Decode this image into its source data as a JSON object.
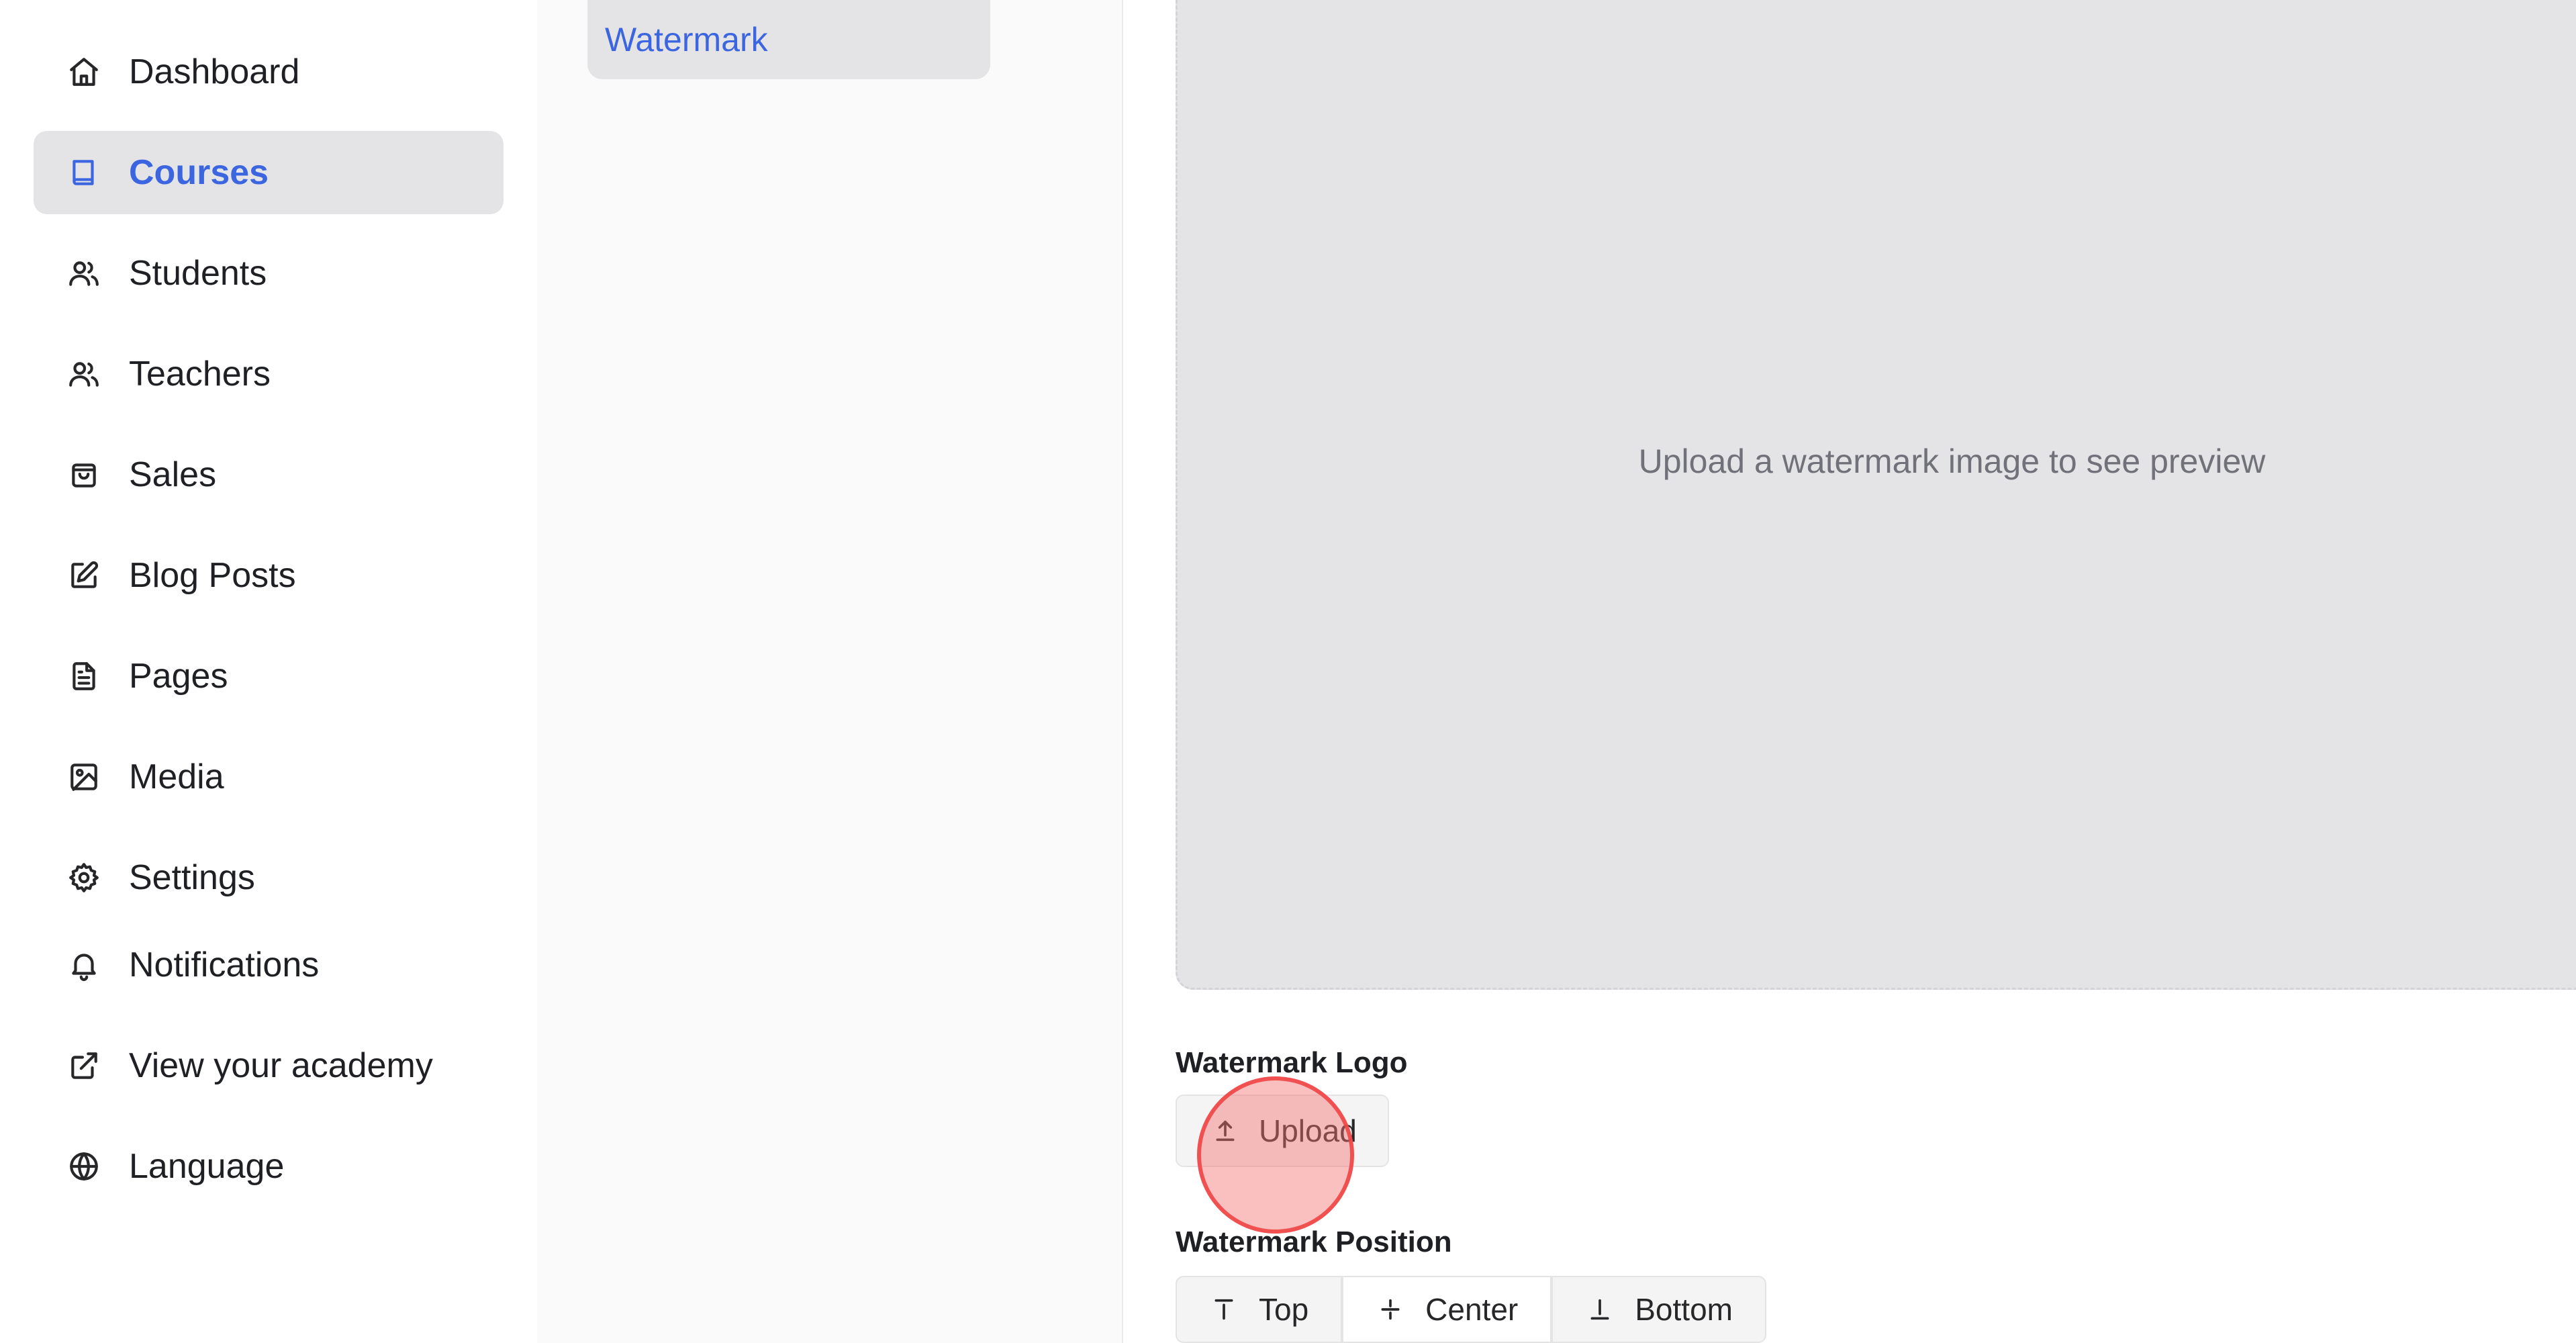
{
  "sidebar": {
    "items": [
      {
        "label": "Dashboard",
        "icon": "home-icon",
        "active": false
      },
      {
        "label": "Courses",
        "icon": "book-icon",
        "active": true
      },
      {
        "label": "Students",
        "icon": "users-icon",
        "active": false
      },
      {
        "label": "Teachers",
        "icon": "users-icon",
        "active": false
      },
      {
        "label": "Sales",
        "icon": "shopping-bag-icon",
        "active": false
      },
      {
        "label": "Blog Posts",
        "icon": "edit-icon",
        "active": false
      },
      {
        "label": "Pages",
        "icon": "file-text-icon",
        "active": false
      },
      {
        "label": "Media",
        "icon": "image-icon",
        "active": false
      },
      {
        "label": "Settings",
        "icon": "gear-icon",
        "active": false
      },
      {
        "label": "Notifications",
        "icon": "bell-icon",
        "active": false
      },
      {
        "label": "View your academy",
        "icon": "external-link-icon",
        "active": false
      },
      {
        "label": "Language",
        "icon": "globe-icon",
        "active": false
      }
    ]
  },
  "subnav": {
    "active_item": "Watermark"
  },
  "main": {
    "preview_placeholder": "Upload a watermark image to see preview",
    "logo_label": "Watermark Logo",
    "upload_label": "Upload",
    "position_label": "Watermark Position",
    "positions": [
      {
        "label": "Top",
        "icon": "align-top-icon",
        "selected": false
      },
      {
        "label": "Center",
        "icon": "align-center-icon",
        "selected": true
      },
      {
        "label": "Bottom",
        "icon": "align-bottom-icon",
        "selected": false
      }
    ]
  },
  "colors": {
    "accent": "#3b66e0",
    "active_bg": "#e4e4e7",
    "muted_text": "#71717a",
    "click_marker": "#ef4444"
  }
}
